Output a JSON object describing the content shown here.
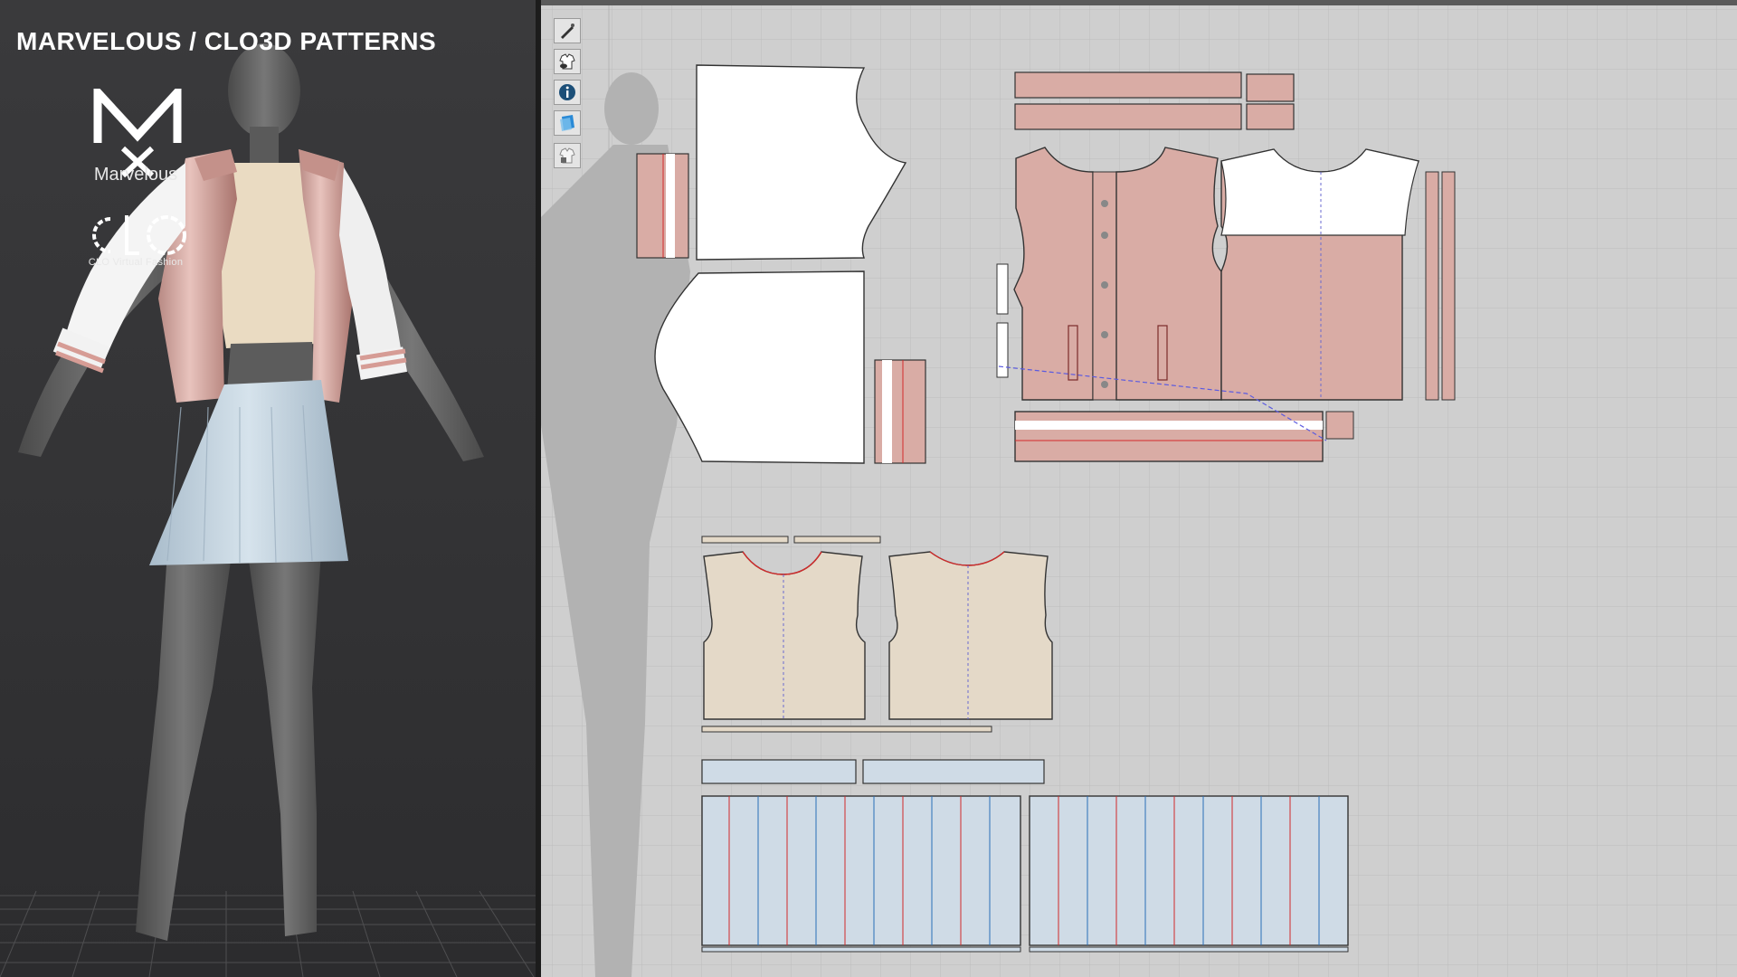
{
  "app": {
    "title": "MARVELOUS / CLO3D PATTERNS"
  },
  "branding": {
    "marvelous_label": "Marvelous",
    "clo_label": "CLO Virtual Fashion"
  },
  "toolbar": {
    "tools": [
      {
        "icon": "pen-icon"
      },
      {
        "icon": "show-garment-icon"
      },
      {
        "icon": "info-icon"
      },
      {
        "icon": "fabric-texture-icon"
      },
      {
        "icon": "lock-garment-icon"
      }
    ]
  },
  "colors": {
    "jacket": "#d9aca5",
    "sleeve_white": "#ffffff",
    "top_beige": "#e4d9c8",
    "skirt_blue": "#cfdbe6",
    "grid_bg": "#cfcfcf",
    "seam_red": "#d22a2a",
    "seam_blue": "#2a6fb8"
  }
}
